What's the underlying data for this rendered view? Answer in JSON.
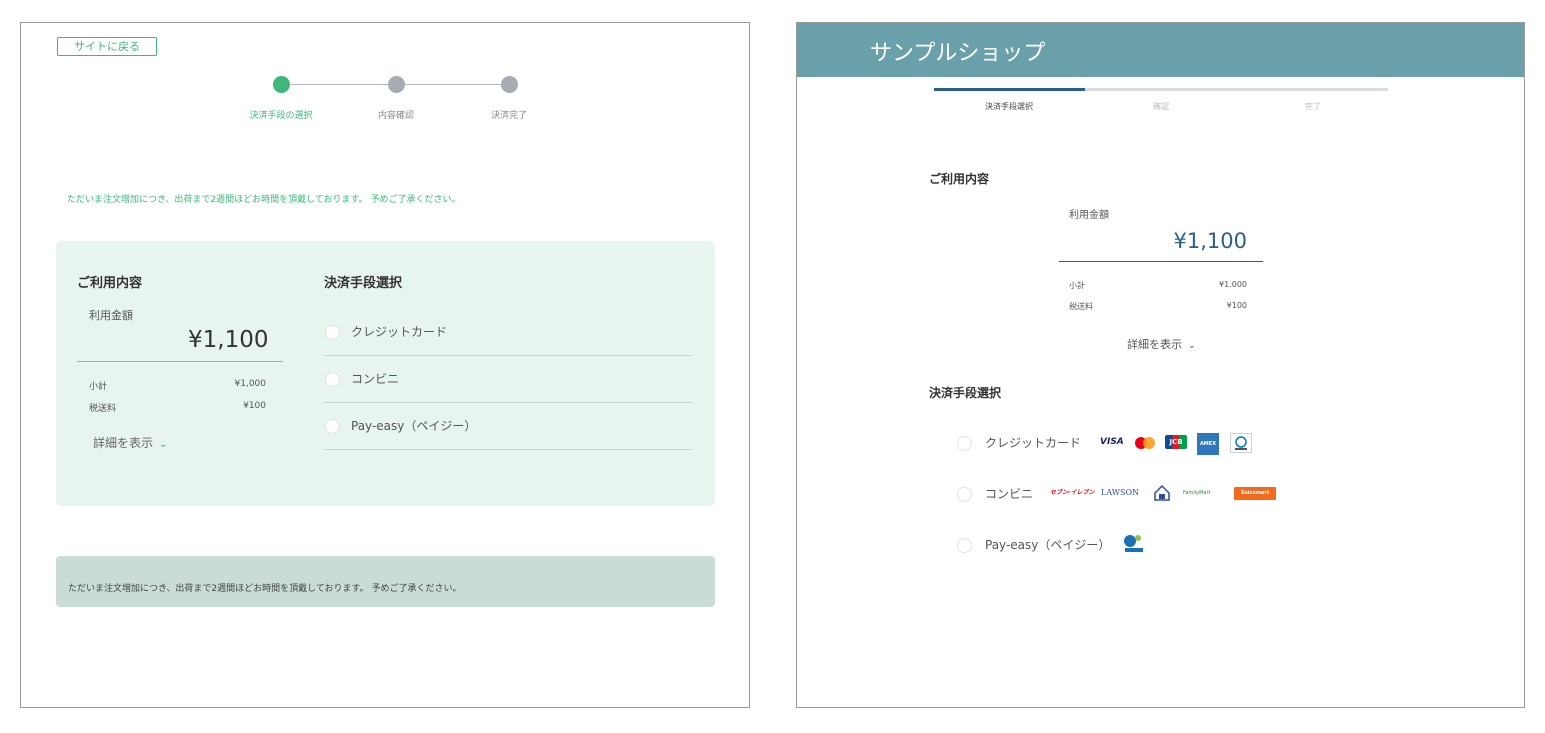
{
  "left": {
    "back_button": "サイトに戻る",
    "steps": [
      "決済手段の選択",
      "内容確認",
      "決済完了"
    ],
    "notice_top": "ただいま注文増加につき、出荷まで2週間ほどお時間を頂戴しております。 予めご了承ください。",
    "summary": {
      "heading": "ご利用内容",
      "amount_label": "利用金額",
      "amount": "¥1,100",
      "subtotal_label": "小計",
      "subtotal_value": "¥1,000",
      "shipping_label": "税送料",
      "shipping_value": "¥100",
      "details_link": "詳細を表示"
    },
    "payment": {
      "heading": "決済手段選択",
      "options": [
        "クレジットカード",
        "コンビニ",
        "Pay-easy（ペイジー）"
      ]
    },
    "notice_bottom": "ただいま注文増加につき、出荷まで2週間ほどお時間を頂戴しております。 予めご了承ください。"
  },
  "right": {
    "shop_title": "サンプルショップ",
    "steps": [
      "決済手段選択",
      "確認",
      "完了"
    ],
    "summary": {
      "heading": "ご利用内容",
      "amount_label": "利用金額",
      "amount": "¥1,100",
      "subtotal_label": "小計",
      "subtotal_value": "¥1.000",
      "shipping_label": "税送料",
      "shipping_value": "¥100",
      "details_link": "詳細を表示"
    },
    "payment": {
      "heading": "決済手段選択",
      "options": [
        "クレジットカード",
        "コンビニ",
        "Pay-easy（ペイジー）"
      ],
      "card_logos": [
        "VISA",
        "JCB",
        "AMEX"
      ],
      "cvs_logos": [
        "セブン-イレブン",
        "LAWSON",
        "FamilyMart",
        "Seicomart"
      ]
    }
  },
  "colors": {
    "accent_green": "#3fb77a",
    "header_teal": "#6aa0a9",
    "accent_navy": "#2c5f87"
  }
}
